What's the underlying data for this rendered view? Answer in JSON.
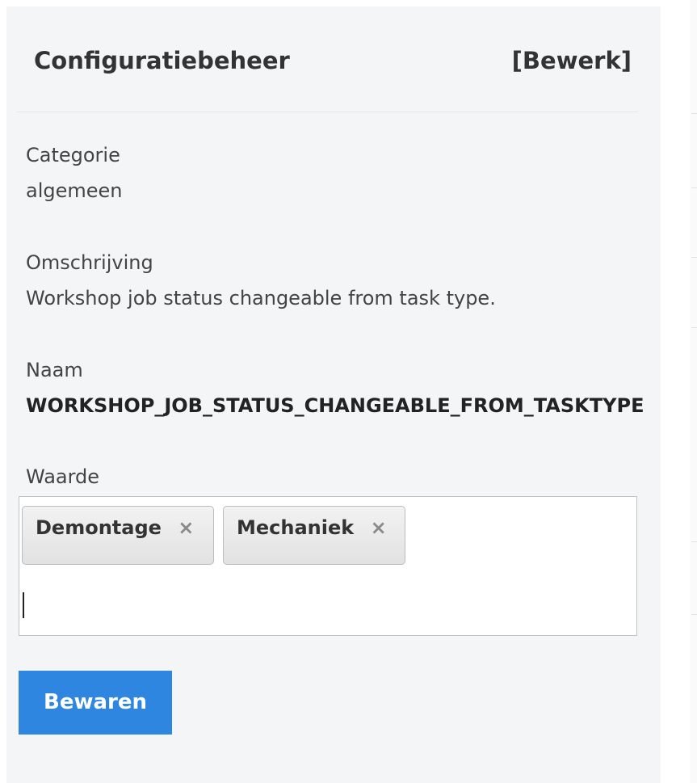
{
  "header": {
    "title": "Configuratiebeheer",
    "edit_label": "[Bewerk]"
  },
  "fields": {
    "category": {
      "label": "Categorie",
      "value": "algemeen"
    },
    "description": {
      "label": "Omschrijving",
      "value": "Workshop job status changeable from task type."
    },
    "name": {
      "label": "Naam",
      "value": "WORKSHOP_JOB_STATUS_CHANGEABLE_FROM_TASKTYPE"
    },
    "value": {
      "label": "Waarde"
    }
  },
  "tags": [
    {
      "label": "Demontage",
      "remove_icon": "×"
    },
    {
      "label": "Mechaniek",
      "remove_icon": "×"
    }
  ],
  "actions": {
    "save_label": "Bewaren"
  },
  "colors": {
    "accent": "#2f86e0",
    "panel_bg": "#f4f5f7"
  }
}
